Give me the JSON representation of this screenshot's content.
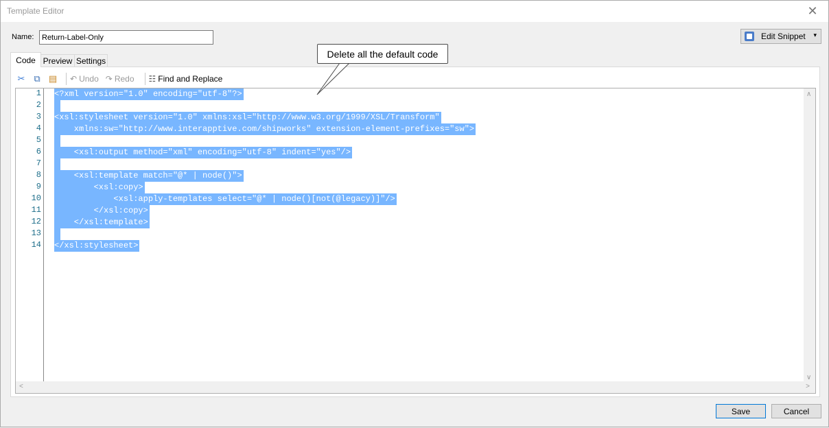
{
  "window": {
    "title": "Template Editor",
    "close_glyph": "✕"
  },
  "name_field": {
    "label": "Name:",
    "value": "Return-Label-Only"
  },
  "snippet_button": {
    "label": "Edit Snippet",
    "arrow": "▾",
    "icon": "snippet-icon"
  },
  "tabs": [
    {
      "label": "Code",
      "active": true
    },
    {
      "label": "Preview",
      "active": false
    },
    {
      "label": "Settings",
      "active": false
    }
  ],
  "toolbar": {
    "cut_glyph": "✂",
    "copy_glyph": "⧉",
    "paste_glyph": "▤",
    "undo_glyph": "↶",
    "redo_glyph": "↷",
    "find_glyph": "☷",
    "undo_label": "Undo",
    "redo_label": "Redo",
    "find_replace_label": "Find and Replace"
  },
  "editor": {
    "line_numbers": [
      "1",
      "2",
      "3",
      "4",
      "5",
      "6",
      "7",
      "8",
      "9",
      "10",
      "11",
      "12",
      "13",
      "14"
    ],
    "lines": [
      "<?xml version=\"1.0\" encoding=\"utf-8\"?>",
      " ",
      "<xsl:stylesheet version=\"1.0\" xmlns:xsl=\"http://www.w3.org/1999/XSL/Transform\"",
      "    xmlns:sw=\"http://www.interapptive.com/shipworks\" extension-element-prefixes=\"sw\">",
      " ",
      "    <xsl:output method=\"xml\" encoding=\"utf-8\" indent=\"yes\"/>",
      " ",
      "    <xsl:template match=\"@* | node()\">",
      "        <xsl:copy>",
      "            <xsl:apply-templates select=\"@* | node()[not(@legacy)]\"/>",
      "        </xsl:copy>",
      "    </xsl:template>",
      " ",
      "</xsl:stylesheet>"
    ],
    "selection_color": "#78b6ff",
    "line_number_color": "#1e6e8a",
    "scroll_glyphs": {
      "up": "∧",
      "down": "∨",
      "left": "<",
      "right": ">"
    }
  },
  "callout": {
    "text": "Delete all the default code"
  },
  "buttons": {
    "save_label": "Save",
    "cancel_label": "Cancel"
  }
}
